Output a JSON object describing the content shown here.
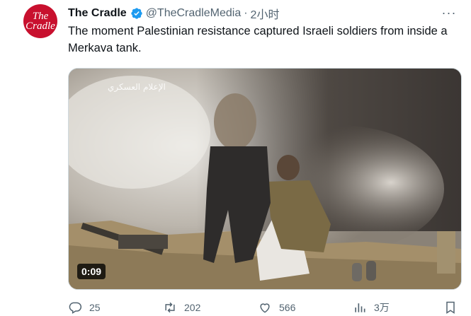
{
  "tweet": {
    "author_name": "The Cradle",
    "avatar_text": [
      "The",
      "Cradle"
    ],
    "handle": "@TheCradleMedia",
    "separator": "·",
    "time": "2小时",
    "more_label": "···",
    "text": "The moment Palestinian resistance captured Israeli soldiers from inside a Merkava tank.",
    "video_duration": "0:09",
    "watermark_text": "الإعلام العسكري"
  },
  "actions": {
    "replies": "25",
    "retweets": "202",
    "likes": "566",
    "views": "3万"
  },
  "colors": {
    "avatar": "#c8102e",
    "verified": "#1d9bf0",
    "secondary_text": "#536471"
  },
  "icons": [
    "verified-badge-icon",
    "more-icon",
    "reply-icon",
    "retweet-icon",
    "like-icon",
    "views-icon",
    "bookmark-icon"
  ]
}
